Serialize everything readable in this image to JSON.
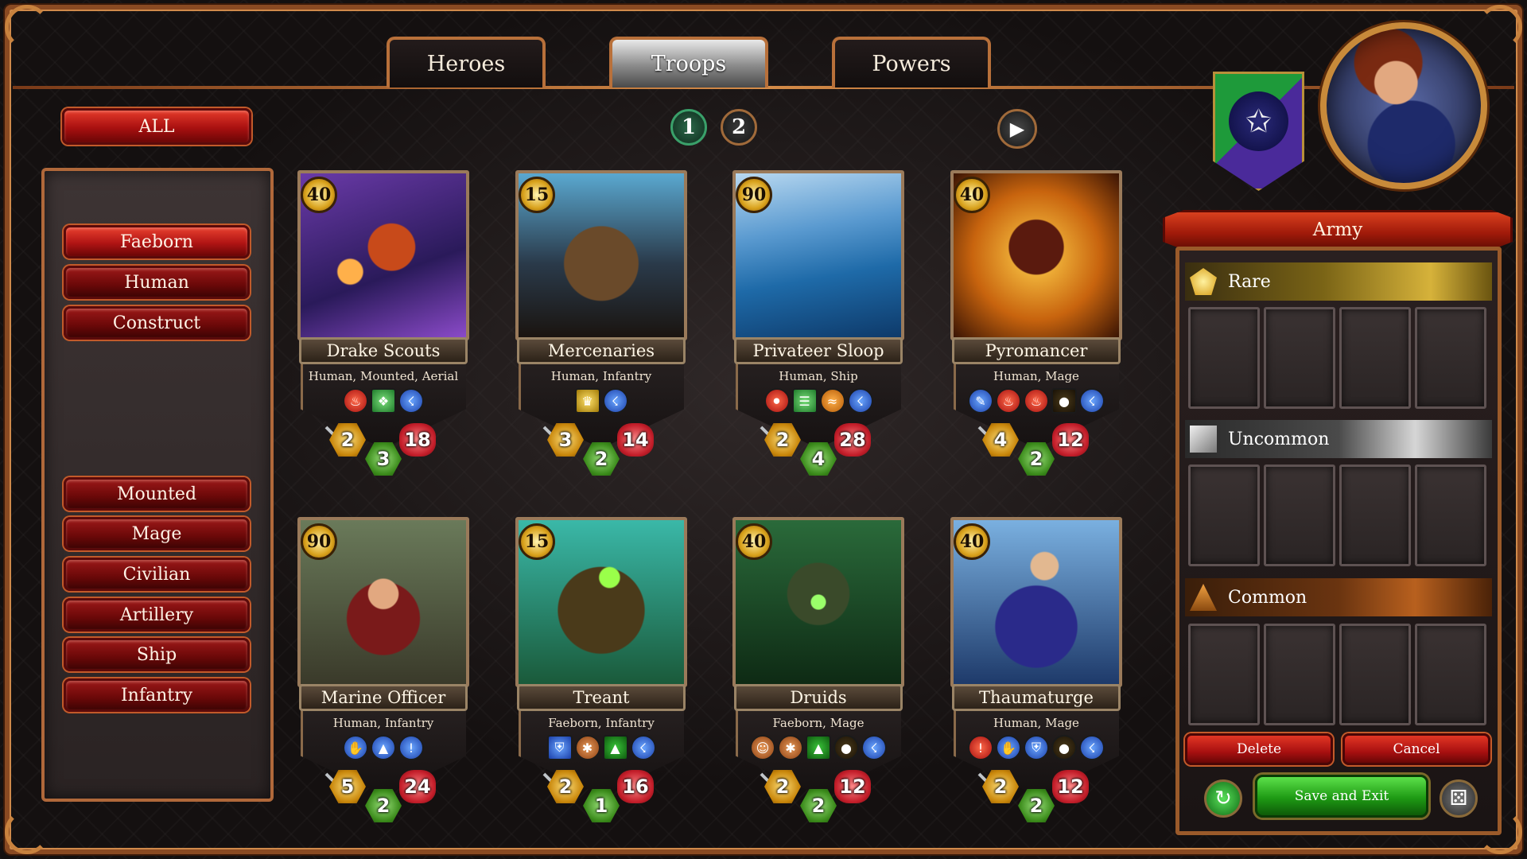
{
  "tabs": [
    {
      "label": "Heroes"
    },
    {
      "label": "Troops"
    },
    {
      "label": "Powers"
    }
  ],
  "filters": {
    "all_label": "ALL",
    "kingdom_group": [
      "Faeborn",
      "Human",
      "Construct"
    ],
    "type_group": [
      "Mounted",
      "Mage",
      "Civilian",
      "Artillery",
      "Ship",
      "Infantry"
    ],
    "selected": "Faeborn"
  },
  "pagination": {
    "pages": [
      "1",
      "2"
    ],
    "current": "1",
    "next_icon": "play-arrow-icon"
  },
  "cards": [
    {
      "name": "Drake Scouts",
      "cost": "40",
      "traits": "Human, Mounted, Aerial",
      "attack": "2",
      "armor": "3",
      "life": "18"
    },
    {
      "name": "Mercenaries",
      "cost": "15",
      "traits": "Human, Infantry",
      "attack": "3",
      "armor": "2",
      "life": "14"
    },
    {
      "name": "Privateer Sloop",
      "cost": "90",
      "traits": "Human, Ship",
      "attack": "2",
      "armor": "4",
      "life": "28"
    },
    {
      "name": "Pyromancer",
      "cost": "40",
      "traits": "Human, Mage",
      "attack": "4",
      "armor": "2",
      "life": "12"
    },
    {
      "name": "Marine Officer",
      "cost": "90",
      "traits": "Human, Infantry",
      "attack": "5",
      "armor": "2",
      "life": "24"
    },
    {
      "name": "Treant",
      "cost": "15",
      "traits": "Faeborn, Infantry",
      "attack": "2",
      "armor": "1",
      "life": "16"
    },
    {
      "name": "Druids",
      "cost": "40",
      "traits": "Faeborn, Mage",
      "attack": "2",
      "armor": "2",
      "life": "12"
    },
    {
      "name": "Thaumaturge",
      "cost": "40",
      "traits": "Human, Mage",
      "attack": "2",
      "armor": "2",
      "life": "12"
    }
  ],
  "army": {
    "title": "Army",
    "rarities": [
      {
        "label": "Rare",
        "icon": "gold-gem-icon"
      },
      {
        "label": "Uncommon",
        "icon": "silver-gem-icon"
      },
      {
        "label": "Common",
        "icon": "bronze-gem-icon"
      }
    ],
    "delete_label": "Delete",
    "cancel_label": "Cancel",
    "save_label": "Save and Exit"
  },
  "colors": {
    "frame": "#b8703a",
    "button_red": "#a81010",
    "save_green": "#1e9a14",
    "cost_gold": "#d9a21c"
  }
}
